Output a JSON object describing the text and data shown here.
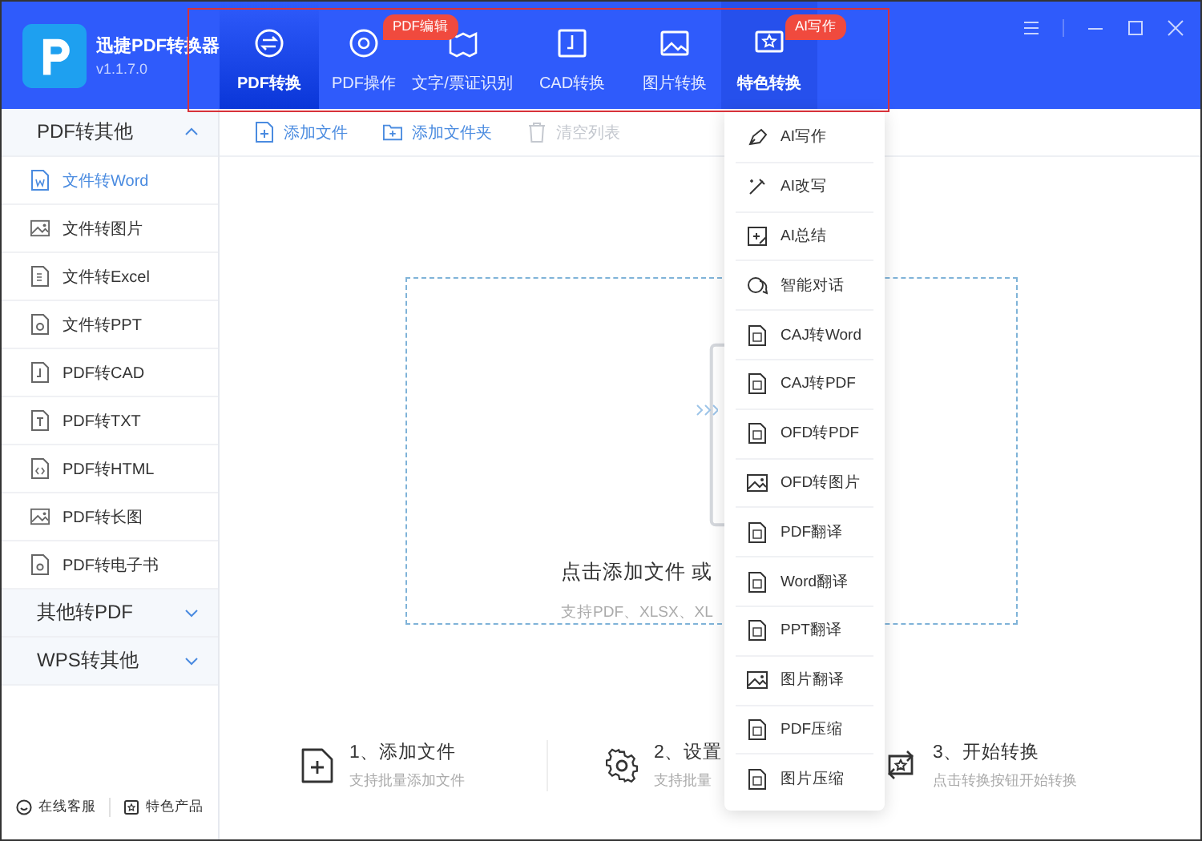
{
  "app": {
    "name": "迅捷PDF转换器",
    "version": "v1.1.7.0"
  },
  "tabs": [
    {
      "label": "PDF转换",
      "selected": true,
      "expanded": false
    },
    {
      "label": "PDF操作",
      "selected": false,
      "expanded": false,
      "badge": "PDF编辑"
    },
    {
      "label": "文字/票证识别",
      "selected": false,
      "expanded": false
    },
    {
      "label": "CAD转换",
      "selected": false,
      "expanded": false
    },
    {
      "label": "图片转换",
      "selected": false,
      "expanded": false
    },
    {
      "label": "特色转换",
      "selected": false,
      "expanded": true,
      "badge": "AI写作"
    }
  ],
  "annotation_frame": true,
  "sidebar": {
    "sections": [
      {
        "label": "PDF转其他",
        "expanded": true,
        "items": [
          {
            "label": "文件转Word",
            "selected": true
          },
          {
            "label": "文件转图片",
            "selected": false
          },
          {
            "label": "文件转Excel",
            "selected": false
          },
          {
            "label": "文件转PPT",
            "selected": false
          },
          {
            "label": "PDF转CAD",
            "selected": false
          },
          {
            "label": "PDF转TXT",
            "selected": false
          },
          {
            "label": "PDF转HTML",
            "selected": false
          },
          {
            "label": "PDF转长图",
            "selected": false
          },
          {
            "label": "PDF转电子书",
            "selected": false
          }
        ]
      },
      {
        "label": "其他转PDF",
        "expanded": false
      },
      {
        "label": "WPS转其他",
        "expanded": false
      }
    ],
    "footer": [
      "在线客服",
      "特色产品"
    ]
  },
  "toolbar": [
    {
      "label": "添加文件",
      "disabled": false
    },
    {
      "label": "添加文件夹",
      "disabled": false
    },
    {
      "label": "清空列表",
      "disabled": true
    }
  ],
  "dropzone": {
    "title": "点击添加文件 或",
    "subtitle": "支持PDF、XLSX、XL"
  },
  "steps": [
    {
      "title": "1、添加文件",
      "subtitle": "支持批量添加文件"
    },
    {
      "title": "2、设置",
      "subtitle": "支持批量"
    },
    {
      "title": "3、开始转换",
      "subtitle": "点击转换按钮开始转换"
    }
  ],
  "menu": {
    "items": [
      "AI写作",
      "AI改写",
      "AI总结",
      "智能对话",
      "CAJ转Word",
      "CAJ转PDF",
      "OFD转PDF",
      "OFD转图片",
      "PDF翻译",
      "Word翻译",
      "PPT翻译",
      "图片翻译",
      "PDF压缩",
      "图片压缩"
    ]
  }
}
